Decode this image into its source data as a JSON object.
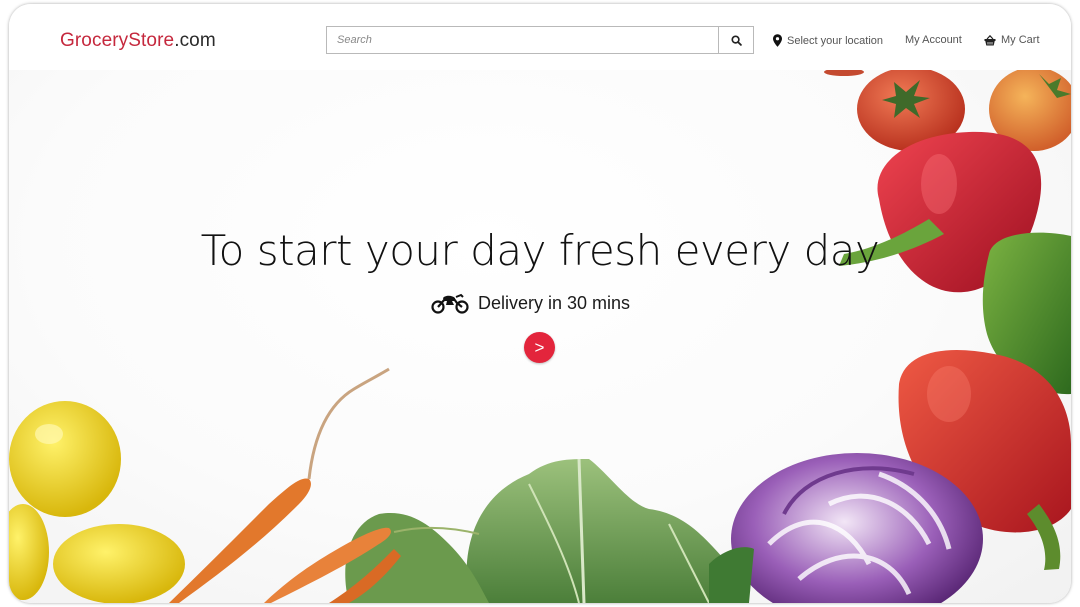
{
  "header": {
    "logo_brand": "GroceryStore",
    "logo_tld": ".com",
    "search_placeholder": "Search",
    "location_label": "Select your location",
    "account_label": "My Account",
    "cart_label": "My Cart"
  },
  "hero": {
    "headline": "To start your day fresh every day",
    "delivery_text": "Delivery in 30 mins",
    "cta_label": ">"
  },
  "colors": {
    "brand_red": "#c5283d",
    "cta_red": "#e3253c",
    "text_dark": "#111111"
  },
  "icons": [
    "search-icon",
    "location-pin-icon",
    "basket-icon",
    "motorcycle-icon"
  ]
}
